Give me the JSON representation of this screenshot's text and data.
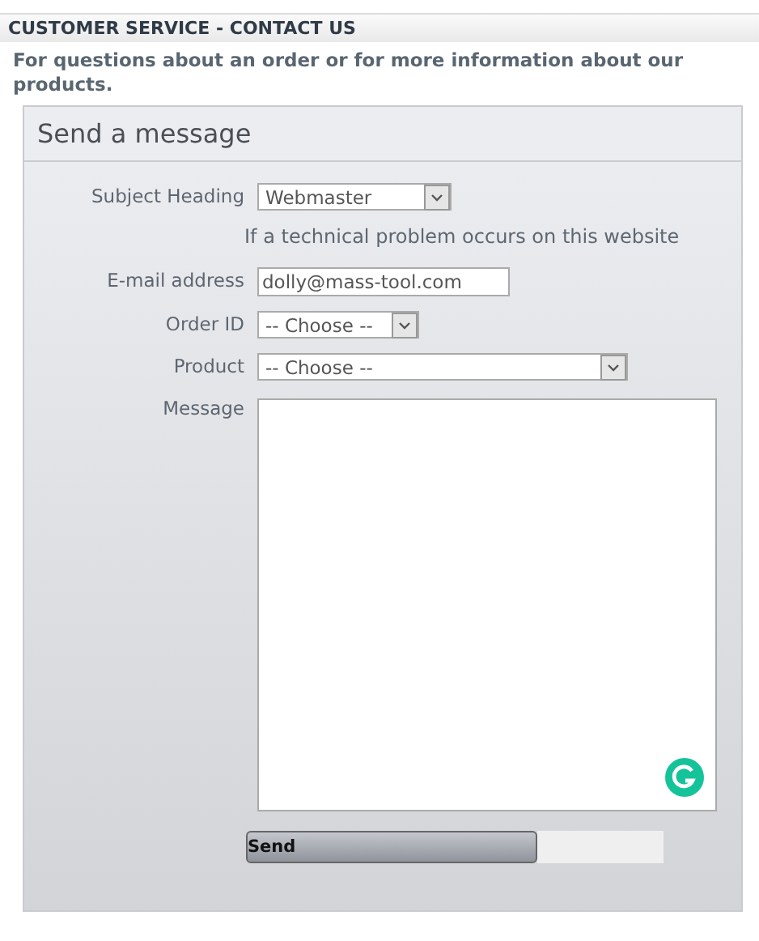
{
  "page_title": "CUSTOMER SERVICE - CONTACT US",
  "intro": "For questions about an order or for more information about our products.",
  "panel": {
    "title": "Send a message",
    "fields": [
      {
        "kind": "select",
        "label": "Subject Heading",
        "value": "Webmaster"
      },
      {
        "kind": "note",
        "text": "If a technical problem occurs on this website"
      },
      {
        "kind": "text",
        "label": "E-mail address",
        "value": "dolly@mass-tool.com"
      },
      {
        "kind": "select",
        "label": "Order ID",
        "value": "-- Choose --"
      },
      {
        "kind": "select",
        "label": "Product",
        "value": "-- Choose --"
      },
      {
        "kind": "textarea",
        "label": "Message"
      }
    ],
    "submit": "Send"
  }
}
